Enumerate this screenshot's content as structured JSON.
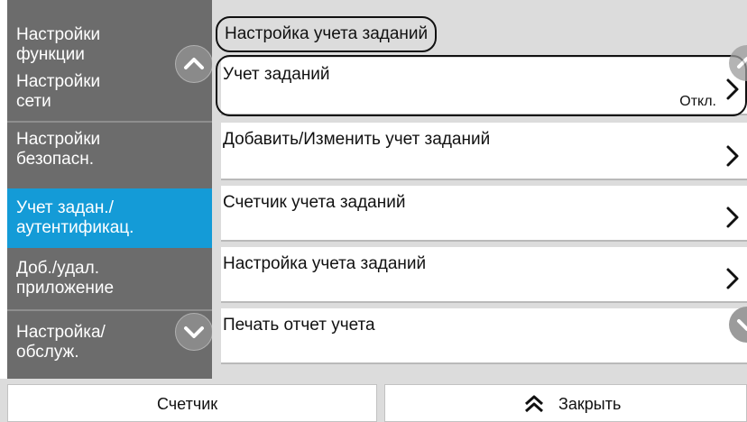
{
  "sidebar": {
    "items": [
      {
        "label_line1": "Настройки",
        "label_line2": "функции"
      },
      {
        "label_line1": "Настройки",
        "label_line2": "сети"
      },
      {
        "label_line1": "Настройки",
        "label_line2": "безопасн."
      },
      {
        "label_line1": "Учет задан./",
        "label_line2": "аутентификац."
      },
      {
        "label_line1": "Доб./удал.",
        "label_line2": "приложение"
      },
      {
        "label_line1": "Настройка/",
        "label_line2": "обслуж."
      }
    ],
    "active_index": 3
  },
  "main": {
    "title": "Настройка учета заданий",
    "rows": [
      {
        "label": "Учет заданий",
        "value": "Откл."
      },
      {
        "label": "Добавить/Изменить учет заданий"
      },
      {
        "label": "Счетчик учета заданий"
      },
      {
        "label": "Настройка учета заданий"
      },
      {
        "label": "Печать отчет учета"
      }
    ]
  },
  "footer": {
    "counter_label": "Счетчик",
    "close_label": "Закрыть"
  },
  "colors": {
    "sidebar_bg": "#6c6c6c",
    "sidebar_active": "#149bd7",
    "main_bg": "#dcdcdc"
  },
  "icons": [
    "chevron-up-icon",
    "chevron-down-icon",
    "chevron-right-icon",
    "double-chevron-up-icon"
  ]
}
